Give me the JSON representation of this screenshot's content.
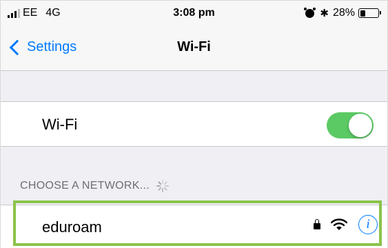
{
  "status_bar": {
    "carrier": "EE",
    "network_type": "4G",
    "time": "3:08 pm",
    "battery_percent": "28%",
    "battery_level": 0.28,
    "icons": [
      "signal-icon",
      "alarm-icon",
      "bluetooth-icon",
      "battery-icon"
    ]
  },
  "nav": {
    "back_label": "Settings",
    "title": "Wi-Fi"
  },
  "wifi_toggle": {
    "label": "Wi-Fi",
    "enabled": true
  },
  "networks_section": {
    "header": "CHOOSE A NETWORK...",
    "networks": [
      {
        "name": "eduroam",
        "secured": true,
        "highlighted": true,
        "highlight_color": "#8bc34a"
      }
    ]
  },
  "colors": {
    "accent": "#007aff",
    "toggle_on": "#5bc964",
    "background": "#efeff4"
  }
}
